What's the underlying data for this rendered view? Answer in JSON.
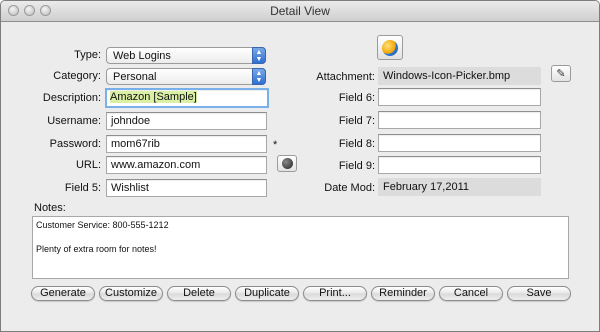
{
  "window": {
    "title": "Detail View"
  },
  "labels": {
    "type": "Type:",
    "category": "Category:",
    "description": "Description:",
    "username": "Username:",
    "password": "Password:",
    "url": "URL:",
    "field5": "Field 5:",
    "attachment": "Attachment:",
    "field6": "Field 6:",
    "field7": "Field 7:",
    "field8": "Field 8:",
    "field9": "Field 9:",
    "date_mod": "Date Mod:",
    "notes": "Notes:",
    "password_marker": "*"
  },
  "values": {
    "type": "Web Logins",
    "category": "Personal",
    "description": "Amazon [Sample]",
    "username": "johndoe",
    "password": "mom67rib",
    "url": "www.amazon.com",
    "field5": "Wishlist",
    "attachment": "Windows-Icon-Picker.bmp",
    "field6": "",
    "field7": "",
    "field8": "",
    "field9": "",
    "date_mod": "February 17,2011"
  },
  "notes": {
    "line1": "Customer Service: 800-555-1212",
    "line2": "",
    "line3": "Plenty of extra room for notes!"
  },
  "buttons": {
    "generate": "Generate",
    "customize": "Customize",
    "delete": "Delete",
    "duplicate": "Duplicate",
    "print": "Print...",
    "reminder": "Reminder",
    "cancel": "Cancel",
    "save": "Save"
  },
  "icons": {
    "entry_icon": "globe-icon",
    "url_go": "globe-icon",
    "attachment_pick": "pen-icon"
  },
  "colors": {
    "focus_ring": "#7ab0e8",
    "selection": "#d9f0a5",
    "popup_arrows": "#2f6fd0"
  }
}
